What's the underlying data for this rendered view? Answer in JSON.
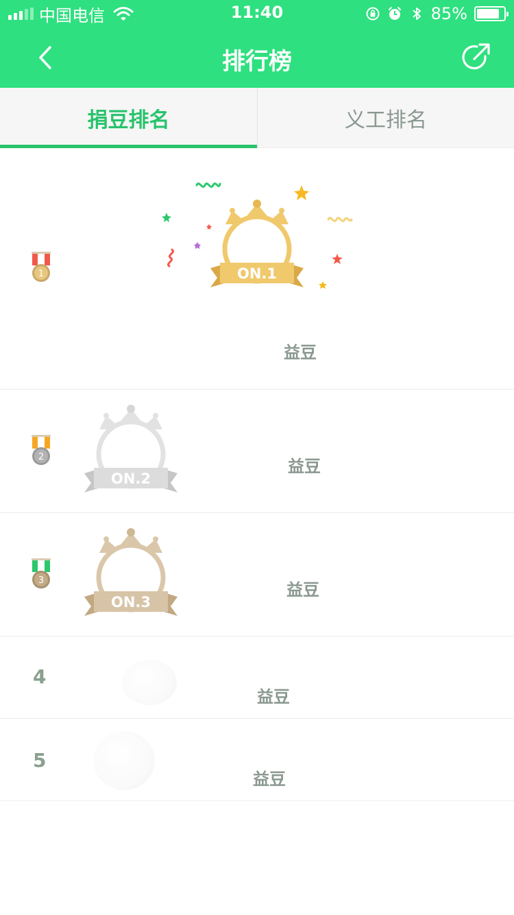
{
  "status_bar": {
    "carrier": "中国电信",
    "time": "11:40",
    "battery_percent_text": "85%",
    "battery_level": 0.85
  },
  "nav": {
    "title": "排行榜"
  },
  "tabs": [
    {
      "label": "捐豆排名",
      "active": true
    },
    {
      "label": "义工排名",
      "active": false
    }
  ],
  "ranking": [
    {
      "rank": "1",
      "badge": "ON.1",
      "unit": "益豆",
      "medal_color": "#f2594a"
    },
    {
      "rank": "2",
      "badge": "ON.2",
      "unit": "益豆",
      "medal_color": "#f7a623"
    },
    {
      "rank": "3",
      "badge": "ON.3",
      "unit": "益豆",
      "medal_color": "#2bc86c"
    },
    {
      "rank": "4",
      "unit": "益豆"
    },
    {
      "rank": "5",
      "unit": "益豆"
    }
  ],
  "colors": {
    "brand_green": "#2ee07f",
    "tab_active": "#28c36c",
    "gold": "#f0c96c",
    "silver": "#dcdcdc",
    "bronze": "#d7c3a6"
  }
}
